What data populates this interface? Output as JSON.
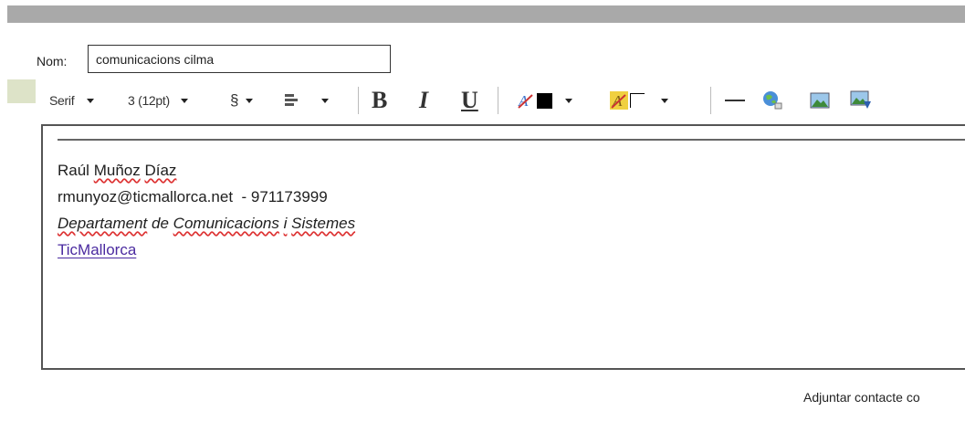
{
  "form": {
    "name_label": "Nom:",
    "name_value": "comunicacions cilma"
  },
  "toolbar": {
    "font_family": "Serif",
    "font_size": "3 (12pt)",
    "paragraph": "§",
    "bold": "B",
    "italic": "I",
    "underline": "U",
    "text_color": "#000000",
    "highlight_color": "#ffffff",
    "icons": [
      "align-icon",
      "text-color-icon",
      "highlight-icon",
      "horizontal-rule-icon",
      "link-globe-icon",
      "image-icon",
      "insert-image-icon"
    ]
  },
  "signature": {
    "name_first": "Raúl",
    "name_surname1": "Muñoz",
    "name_surname2": "Díaz",
    "contact": "rmunyoz@ticmallorca.net  - 971173999",
    "dept_word1": "Departament",
    "dept_word2": "de",
    "dept_word3": "Comunicacions",
    "dept_word4": "i",
    "dept_word5": "Sistemes",
    "link_text": "TicMallorca"
  },
  "footer": {
    "attach_label": "Adjuntar contacte co"
  },
  "colors": {
    "topbar": "#a9a9a9",
    "link": "#4b2ba0",
    "spellcheck": "#dd3333",
    "swatch": "#dde3c8"
  }
}
